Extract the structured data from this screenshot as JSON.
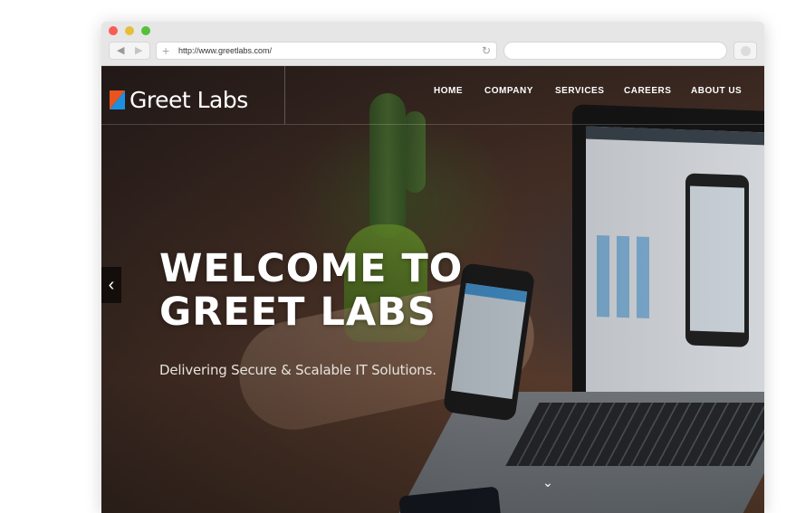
{
  "browser": {
    "url": "http://www.greetlabs.com/",
    "back_glyph": "◀",
    "forward_glyph": "▶",
    "plus_glyph": "+",
    "reload_glyph": "↻",
    "icons": [
      "back-icon",
      "forward-icon",
      "new-tab-icon",
      "reload-icon",
      "extension-icon"
    ]
  },
  "site": {
    "logo_text": "Greet Labs",
    "logo_colors": {
      "orange": "#e8541c",
      "blue": "#1e8fe0"
    },
    "nav": [
      "HOME",
      "COMPANY",
      "SERVICES",
      "CAREERS",
      "ABOUT US"
    ],
    "hero": {
      "title_line1": "WELCOME TO",
      "title_line2": "GREET LABS",
      "subtitle": "Delivering Secure & Scalable IT Solutions."
    },
    "carousel": {
      "prev_glyph": "‹",
      "scroll_glyph": "⌄"
    }
  }
}
